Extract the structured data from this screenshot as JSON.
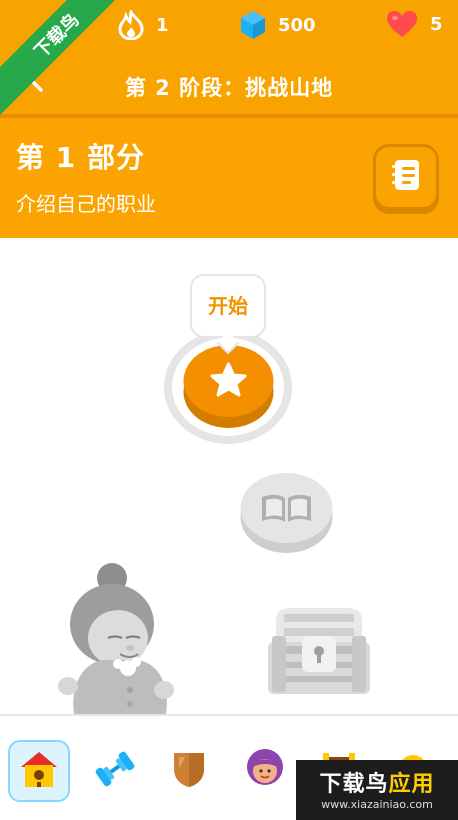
{
  "header": {
    "streak_count": "1",
    "gems_count": "500",
    "hearts_count": "5",
    "stage_title": "第 2 阶段：挑战山地"
  },
  "unit": {
    "title": "第 1 部分",
    "subtitle": "介绍自己的职业"
  },
  "path": {
    "start_label": "开始"
  },
  "watermark": {
    "corner_text": "下载鸟",
    "brand_prefix": "下载鸟",
    "brand_suffix": "应用",
    "url": "www.xiazainiao.com"
  },
  "nav": {
    "items": [
      "home-icon",
      "practice-dumbbell-icon",
      "league-shield-icon",
      "profile-avatar-icon",
      "shop-icon",
      "more-icon"
    ]
  },
  "colors": {
    "primary_orange": "#f8a300",
    "dark_orange": "#e58f00",
    "node_orange": "#f49000",
    "locked_gray": "#e5e5e5",
    "active_nav_bg": "#ddf4ff",
    "gem_blue": "#1cb0f6",
    "heart_red": "#ff4b4b"
  }
}
